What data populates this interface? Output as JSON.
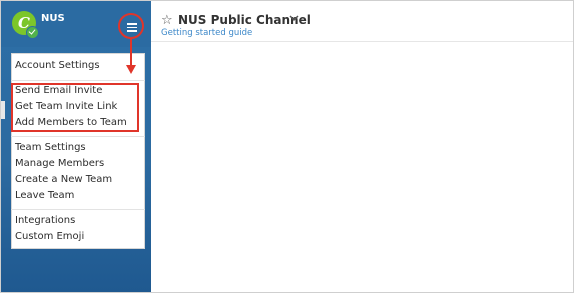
{
  "sidebar": {
    "team_initial": "C",
    "team_name": "NUS",
    "menu": {
      "group1": [
        "Account Settings"
      ],
      "group2": [
        "Send Email Invite",
        "Get Team Invite Link",
        "Add Members to Team"
      ],
      "group3": [
        "Team Settings",
        "Manage Members",
        "Create a New Team",
        "Leave Team"
      ],
      "group4": [
        "Integrations",
        "Custom Emoji"
      ]
    }
  },
  "channel": {
    "title": "NUS Public Channel",
    "subtitle": "Getting started guide"
  },
  "icons": {
    "star": "star-outline-icon",
    "chevron": "chevron-down-icon",
    "menu": "hamburger-menu-icon"
  },
  "colors": {
    "sidebar": "#2c6aa0",
    "accent": "#3d88c9",
    "highlight": "#e0352a",
    "avatar": "#7cc62a"
  }
}
